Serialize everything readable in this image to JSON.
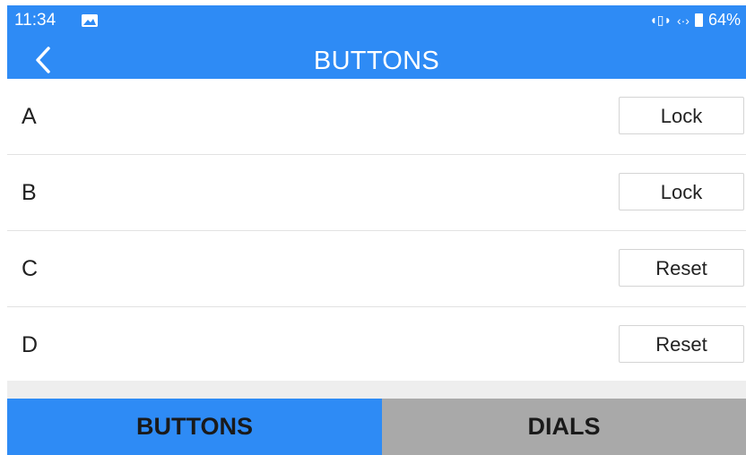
{
  "status_bar": {
    "time": "11:34",
    "battery": "64%",
    "icons": [
      "image-icon",
      "vibrate-icon",
      "sync-icon",
      "battery-icon"
    ]
  },
  "header": {
    "title": "BUTTONS",
    "back_icon": "chevron-left-icon",
    "color": "#2e8bf5"
  },
  "rows": [
    {
      "label": "A",
      "action": "Lock"
    },
    {
      "label": "B",
      "action": "Lock"
    },
    {
      "label": "C",
      "action": "Reset"
    },
    {
      "label": "D",
      "action": "Reset"
    }
  ],
  "tabs": [
    {
      "label": "BUTTONS",
      "active": true
    },
    {
      "label": "DIALS",
      "active": false
    }
  ],
  "colors": {
    "accent": "#2e8bf5",
    "tab_inactive": "#a9a9a9",
    "divider": "#e2e2e2"
  }
}
